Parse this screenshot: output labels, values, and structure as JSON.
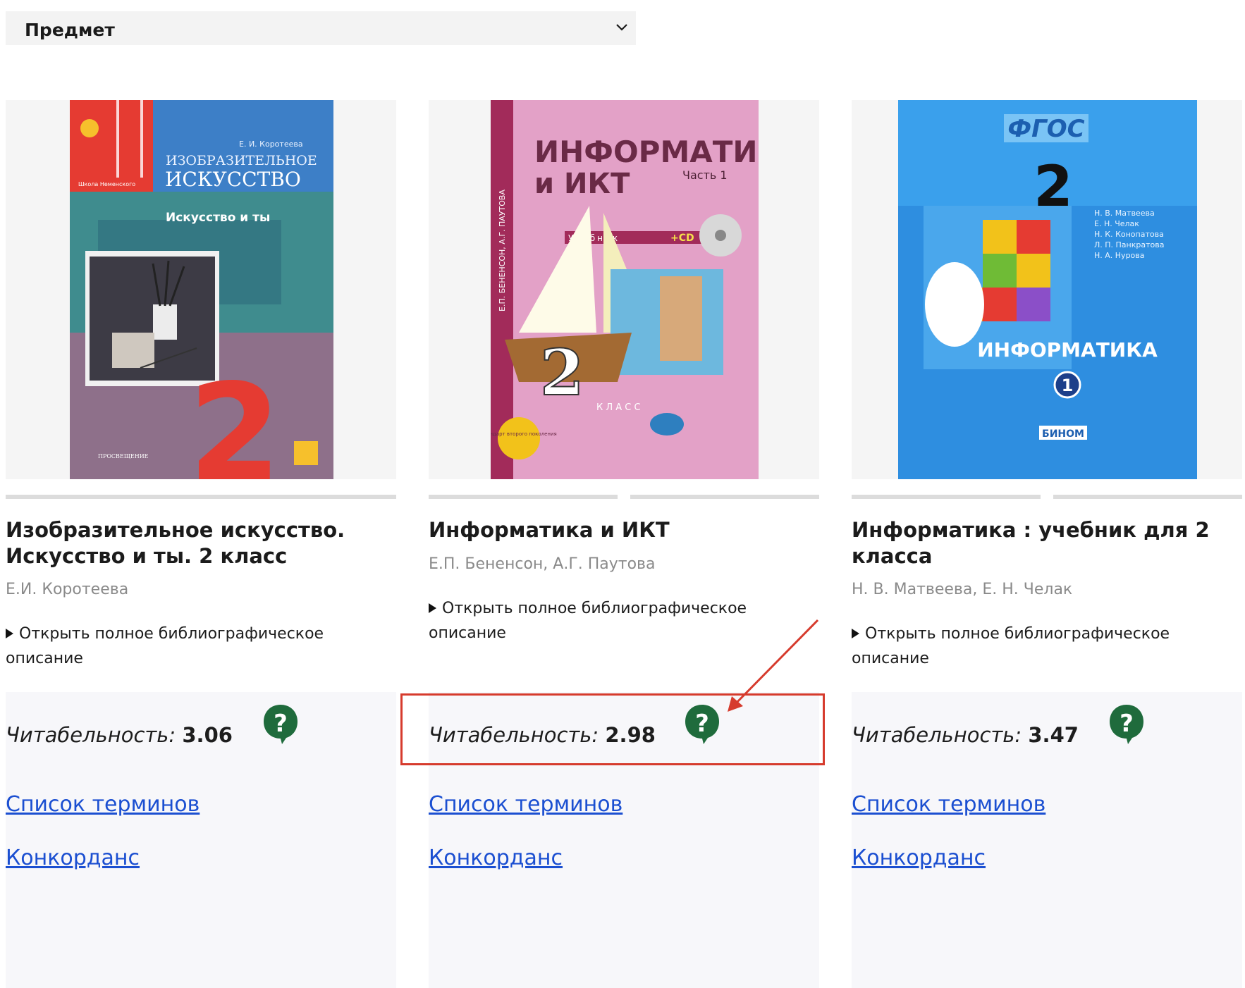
{
  "filter": {
    "label": "Предмет"
  },
  "books": [
    {
      "title": "Изобразительное искусство. Искусство и ты. 2 класс",
      "authors": "Е.И. Коротеева",
      "biblio_link": "Открыть полное библиографическое описание",
      "readability_label": "Читабельность:",
      "readability_value": "3.06",
      "terms_link": "Список терминов",
      "concordance_link": "Конкорданс",
      "cover": {
        "author": "Е. И. Коротеева",
        "title_line1": "ИЗОБРАЗИТЕЛЬНОЕ",
        "title_line2": "ИСКУССТВО",
        "subtitle": "Искусство и ты",
        "school": "Школа Неменского",
        "grade": "2",
        "publisher": "ПРОСВЕЩЕНИЕ"
      }
    },
    {
      "title": "Информатика и ИКТ",
      "authors": "Е.П. Бененсон, А.Г. Паутова",
      "biblio_link": "Открыть полное библиографическое описание",
      "readability_label": "Читабельность:",
      "readability_value": "2.98",
      "terms_link": "Список терминов",
      "concordance_link": "Конкорданс",
      "cover": {
        "title_line1": "ИНФОРМАТИКА",
        "title_line2": "и ИКТ",
        "part": "Часть 1",
        "kind": "Учебник",
        "cd": "+CD",
        "spine_authors": "Е.П. БЕНЕНСОН, А.Г. ПАУТОВА",
        "grade": "2",
        "grade_word": "К Л А С С",
        "standard": "стандарт второго поколения"
      }
    },
    {
      "title": "Информатика : учебник для 2 класса",
      "authors": "Н. В. Матвеева, Е. Н. Челак",
      "biblio_link": "Открыть полное библиографическое описание",
      "readability_label": "Читабельность:",
      "readability_value": "3.47",
      "terms_link": "Список терминов",
      "concordance_link": "Конкорданс",
      "cover": {
        "badge": "ФГОС",
        "grade": "2",
        "authors": [
          "Н. В. Матвеева",
          "Е. Н. Челак",
          "Н. К. Конопатова",
          "Л. П. Панкратова",
          "Н. А. Нурова"
        ],
        "title": "ИНФОРМАТИКА",
        "part": "1",
        "publisher": "БИНОМ"
      }
    }
  ],
  "colors": {
    "link": "#1b4fd1",
    "help_icon": "#1f6b3c",
    "highlight": "#d63b2d"
  }
}
